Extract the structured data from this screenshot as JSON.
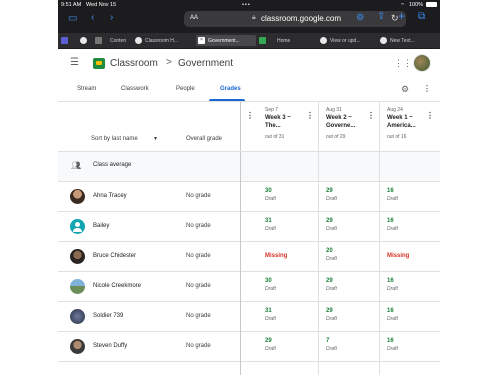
{
  "status_bar": {
    "time": "9:51 AM",
    "date": "Wed Nov 15",
    "battery": "100%"
  },
  "browser": {
    "text_size": "AA",
    "url": "classroom.google.com",
    "tabs": [
      {
        "label": ""
      },
      {
        "label": ""
      },
      {
        "label": ""
      },
      {
        "label": "Conten"
      },
      {
        "label": "Classroom H..."
      },
      {
        "label": "Government..."
      },
      {
        "label": "Home"
      },
      {
        "label": "View or upd..."
      },
      {
        "label": "New Text..."
      }
    ]
  },
  "header": {
    "app_name": "Classroom",
    "separator": ">",
    "class_name": "Government"
  },
  "nav_tabs": [
    "Stream",
    "Classwork",
    "People",
    "Grades"
  ],
  "grid": {
    "sort_label": "Sort by last name",
    "overall_header": "Overall grade",
    "class_average_label": "Class average",
    "assignments": [
      {
        "date": "Sep 7",
        "title_line1": "Week 3 ~",
        "title_line2": "The...",
        "out_of": "out of 31"
      },
      {
        "date": "Aug 31",
        "title_line1": "Week 2 ~",
        "title_line2": "Governe...",
        "out_of": "out of 29"
      },
      {
        "date": "Aug 24",
        "title_line1": "Week 1 ~",
        "title_line2": "America...",
        "out_of": "out of 16"
      }
    ],
    "students": [
      {
        "name": "Ahna Tracey",
        "overall": "No grade",
        "grades": [
          {
            "score": "30",
            "draft": "Draft"
          },
          {
            "score": "29",
            "draft": "Draft"
          },
          {
            "score": "16",
            "draft": "Draft"
          }
        ]
      },
      {
        "name": "Bailey",
        "overall": "No grade",
        "grades": [
          {
            "score": "31",
            "draft": "Draft"
          },
          {
            "score": "29",
            "draft": "Draft"
          },
          {
            "score": "16",
            "draft": "Draft"
          }
        ]
      },
      {
        "name": "Bruce Chidester",
        "overall": "No grade",
        "grades": [
          {
            "score": "Missing",
            "draft": ""
          },
          {
            "score": "20",
            "draft": "Draft"
          },
          {
            "score": "Missing",
            "draft": ""
          }
        ]
      },
      {
        "name": "Nicole Creekmore",
        "overall": "No grade",
        "grades": [
          {
            "score": "30",
            "draft": "Draft"
          },
          {
            "score": "29",
            "draft": "Draft"
          },
          {
            "score": "16",
            "draft": "Draft"
          }
        ]
      },
      {
        "name": "Soldier 739",
        "overall": "No grade",
        "grades": [
          {
            "score": "31",
            "draft": "Draft"
          },
          {
            "score": "29",
            "draft": "Draft"
          },
          {
            "score": "16",
            "draft": "Draft"
          }
        ]
      },
      {
        "name": "Steven Duffy",
        "overall": "No grade",
        "grades": [
          {
            "score": "29",
            "draft": "Draft"
          },
          {
            "score": "7",
            "draft": "Draft"
          },
          {
            "score": "16",
            "draft": "Draft"
          }
        ]
      }
    ]
  },
  "colors": {
    "graded": "#188038",
    "missing": "#d93025",
    "accent": "#1967d2",
    "browser_accent": "#3b8df5"
  }
}
